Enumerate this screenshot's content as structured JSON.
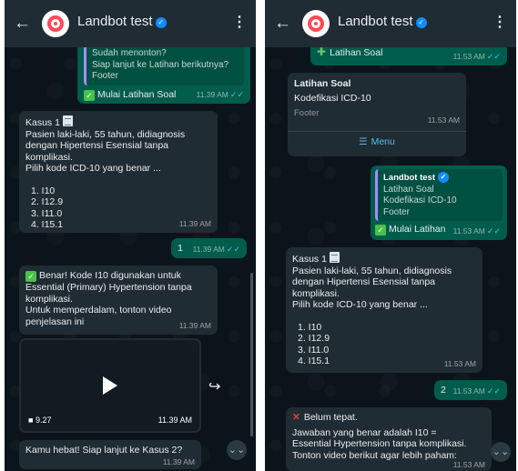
{
  "app": {
    "title": "Landbot test",
    "back_icon": "arrow-left-icon",
    "menu_icon": "kebab-icon",
    "verified_color": "#0f8cff"
  },
  "left": {
    "top_bubble": {
      "line1": "Sudah menonton?",
      "line2": "Siap lanjut ke Latihan berikutnya?",
      "footer": "Footer",
      "button": "Mulai Latihan Soal",
      "time": "11.39 AM"
    },
    "kasus_bubble": {
      "title": "Kasus 1",
      "text1": "Pasien laki-laki, 55 tahun, didiagnosis",
      "text2": "dengan Hipertensi Esensial tanpa",
      "text3": "komplikasi.",
      "text4": "Pilih kode ICD-10 yang benar ...",
      "options": [
        "1. I10",
        "2. I12.9",
        "3. I11.0",
        "4. I15.1"
      ],
      "time": "11.39 AM"
    },
    "reply_bubble": {
      "text": "1",
      "time": "11.39 AM"
    },
    "benar_bubble": {
      "line1": "Benar! Kode I10 digunakan untuk",
      "line2": "Essential (Primary) Hypertension tanpa",
      "line3": "komplikasi.",
      "line4": "Untuk memperdalam, tonton video",
      "line5": "penjelasan ini",
      "time": "11.39 AM"
    },
    "video": {
      "duration": "9.27",
      "time": "11.39 AM"
    },
    "last_bubble": {
      "text": "Kamu hebat! Siap lanjut ke Kasus 2?",
      "time": "11.39 AM"
    }
  },
  "right": {
    "top_bubble": {
      "button": "Latihan Soal",
      "time": "11.53 AM"
    },
    "list_bubble": {
      "title": "Latihan Soal",
      "body": "Kodefikasi ICD-10",
      "footer": "Footer",
      "time": "11.53 AM",
      "menu": "Menu"
    },
    "out_bubble": {
      "quote_title": "Landbot test",
      "q1": "Latihan Soal",
      "q2": "Kodefikasi ICD-10",
      "q3": "Footer",
      "button": "Mulai Latihan",
      "time": "11.53 AM"
    },
    "kasus_bubble": {
      "title": "Kasus 1",
      "text1": "Pasien laki-laki, 55 tahun, didiagnosis",
      "text2": "dengan Hipertensi Esensial tanpa",
      "text3": "komplikasi.",
      "text4": "Pilih kode ICD-10 yang benar ...",
      "options": [
        "1. I10",
        "2. I12.9",
        "3. I11.0",
        "4. I15.1"
      ],
      "time": "11.53 AM"
    },
    "reply_bubble": {
      "text": "2",
      "time": "11.53 AM"
    },
    "salah_bubble": {
      "line1": "Belum tepat.",
      "line2": "Jawaban yang benar adalah I10 =",
      "line3": "Essential Hypertension tanpa komplikasi.",
      "line4": "Tonton video berikut agar lebih paham:",
      "time": "11.53 AM"
    }
  }
}
